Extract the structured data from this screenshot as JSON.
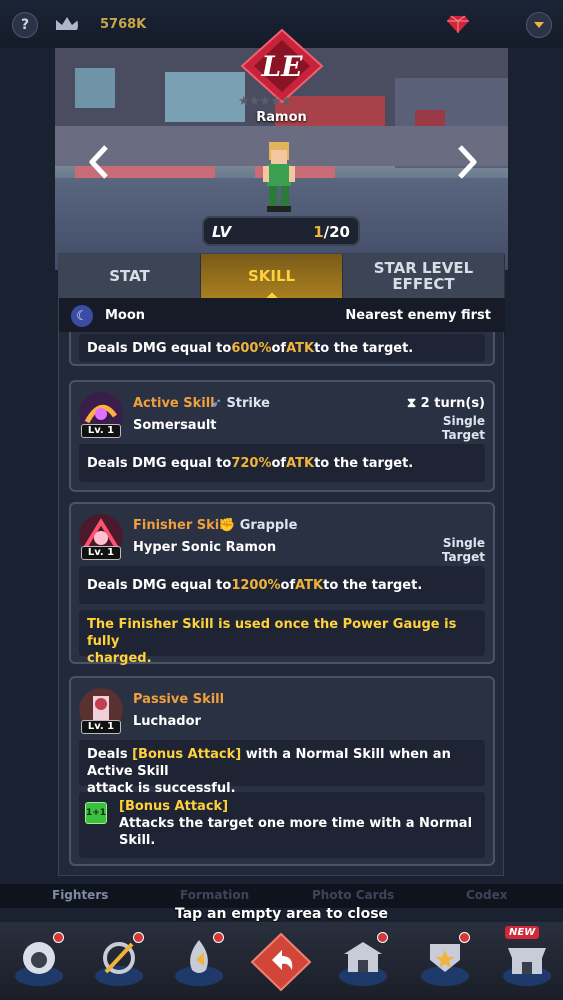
{
  "topbar": {
    "help_icon": "question-icon",
    "rank_icon": "crown-icon",
    "currency_value": "5768K",
    "gem_icon": "ruby-icon",
    "dropdown_icon": "chevron-down-icon"
  },
  "hero": {
    "emblem_text": "LE",
    "name": "Ramon",
    "stars": "★★★★★",
    "level_label": "LV",
    "level_current": "1",
    "level_max": "/20"
  },
  "tabs": [
    {
      "label": "STAT"
    },
    {
      "label": "SKILL"
    },
    {
      "label": "STAR LEVEL EFFECT"
    }
  ],
  "info": {
    "element": "Moon",
    "targeting": "Nearest enemy first"
  },
  "skills": {
    "partial": {
      "desc_pre": "Deals DMG equal to ",
      "desc_pct": "600%",
      "desc_mid": " of ",
      "desc_stat": "ATK",
      "desc_post": " to the target."
    },
    "active": {
      "type": "Active Skill",
      "attr": "Strike",
      "name": "Somersault",
      "level": "Lv. 1",
      "turns": "2 turn(s)",
      "range_line1": "Single",
      "range_line2": "Target",
      "desc_pre": "Deals DMG equal to ",
      "desc_pct": "720%",
      "desc_mid": " of ",
      "desc_stat": "ATK",
      "desc_post": " to the target."
    },
    "finisher": {
      "type": "Finisher Skill",
      "attr": "Grapple",
      "name": "Hyper Sonic Ramon",
      "level": "Lv. 1",
      "range_line1": "Single",
      "range_line2": "Target",
      "desc_pre": "Deals DMG equal to ",
      "desc_pct": "1200%",
      "desc_mid": " of ",
      "desc_stat": "ATK",
      "desc_post": " to the target.",
      "note_line1": "The Finisher Skill is used once the Power Gauge is fully",
      "note_line2": "charged."
    },
    "passive": {
      "type": "Passive Skill",
      "name": "Luchador",
      "level": "Lv. 1",
      "desc_pre": "Deals ",
      "desc_bonus": "[Bonus Attack]",
      "desc_post": " with a Normal Skill when an Active Skill",
      "desc_line2": "attack is successful.",
      "bonus_icon": "1+1",
      "bonus_title": "[Bonus Attack]",
      "bonus_line1": "Attacks the target one more time with a Normal",
      "bonus_line2": "Skill."
    }
  },
  "bottom_tabs": [
    "Fighters",
    "Formation",
    "Photo Cards",
    "Codex"
  ],
  "close_hint": "Tap an empty area to close",
  "nav": {
    "items": [
      "fighter-icon",
      "gear-sword-icon",
      "flame-upgrade-icon",
      "back-arrow-icon",
      "dojo-icon",
      "medal-icon",
      "shop-icon"
    ],
    "new_tag": "NEW"
  },
  "colors": {
    "accent": "#f0b43c",
    "tab_active": "#ffd23b",
    "panel": "#22293a"
  }
}
